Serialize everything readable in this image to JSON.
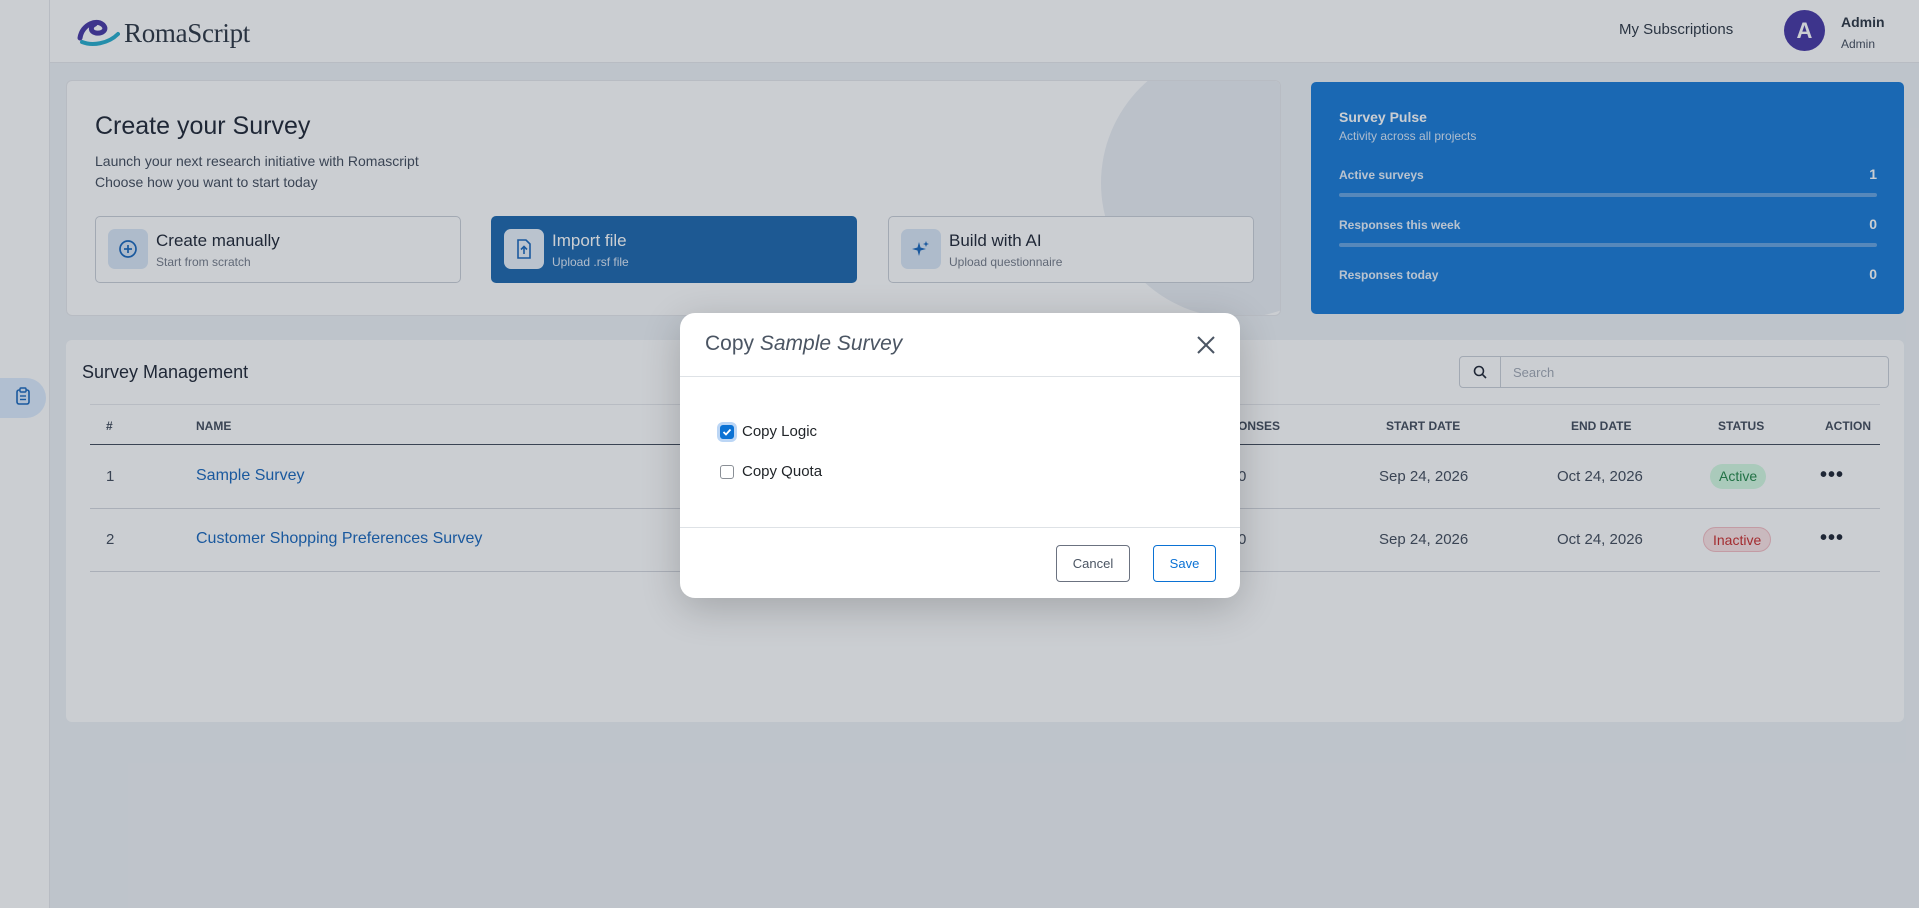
{
  "brand": {
    "name": "RomaScript"
  },
  "header": {
    "subscriptions_label": "My Subscriptions",
    "avatar_initial": "A",
    "user_name": "Admin",
    "user_role": "Admin"
  },
  "create": {
    "title": "Create your Survey",
    "subtitle_1": "Launch your next research initiative with Romascript",
    "subtitle_2": "Choose how you want to start today",
    "options": [
      {
        "title": "Create manually",
        "subtitle": "Start from scratch",
        "icon": "plus-circle-icon"
      },
      {
        "title": "Import file",
        "subtitle": "Upload .rsf file",
        "icon": "file-upload-icon"
      },
      {
        "title": "Build with AI",
        "subtitle": "Upload questionnaire",
        "icon": "sparkle-icon"
      }
    ]
  },
  "pulse": {
    "title": "Survey Pulse",
    "subtitle": "Activity across all projects",
    "metrics": [
      {
        "label": "Active surveys",
        "value": "1"
      },
      {
        "label": "Responses this week",
        "value": "0"
      },
      {
        "label": "Responses today",
        "value": "0"
      }
    ]
  },
  "management": {
    "title": "Survey Management",
    "search_placeholder": "Search",
    "columns": {
      "num": "#",
      "name": "NAME",
      "responses": "ONSES",
      "start": "START DATE",
      "end": "END DATE",
      "status": "STATUS",
      "action": "ACTION"
    },
    "rows": [
      {
        "num": "1",
        "name": "Sample Survey",
        "responses": "0",
        "start": "Sep 24, 2026",
        "end": "Oct 24, 2026",
        "status": "Active"
      },
      {
        "num": "2",
        "name": "Customer Shopping Preferences Survey",
        "responses": "0",
        "start": "Sep 24, 2026",
        "end": "Oct 24, 2026",
        "status": "Inactive"
      }
    ],
    "action_label": "•••"
  },
  "modal": {
    "title_prefix": "Copy ",
    "title_name": "Sample Survey",
    "options": [
      {
        "label": "Copy Logic",
        "checked": true
      },
      {
        "label": "Copy Quota",
        "checked": false
      }
    ],
    "cancel_label": "Cancel",
    "save_label": "Save"
  },
  "colors": {
    "primary": "#0b72d4",
    "import_active": "#0e5ea8",
    "link": "#0b5db8",
    "active_badge": "#15803d",
    "inactive_badge": "#c81e1e"
  }
}
